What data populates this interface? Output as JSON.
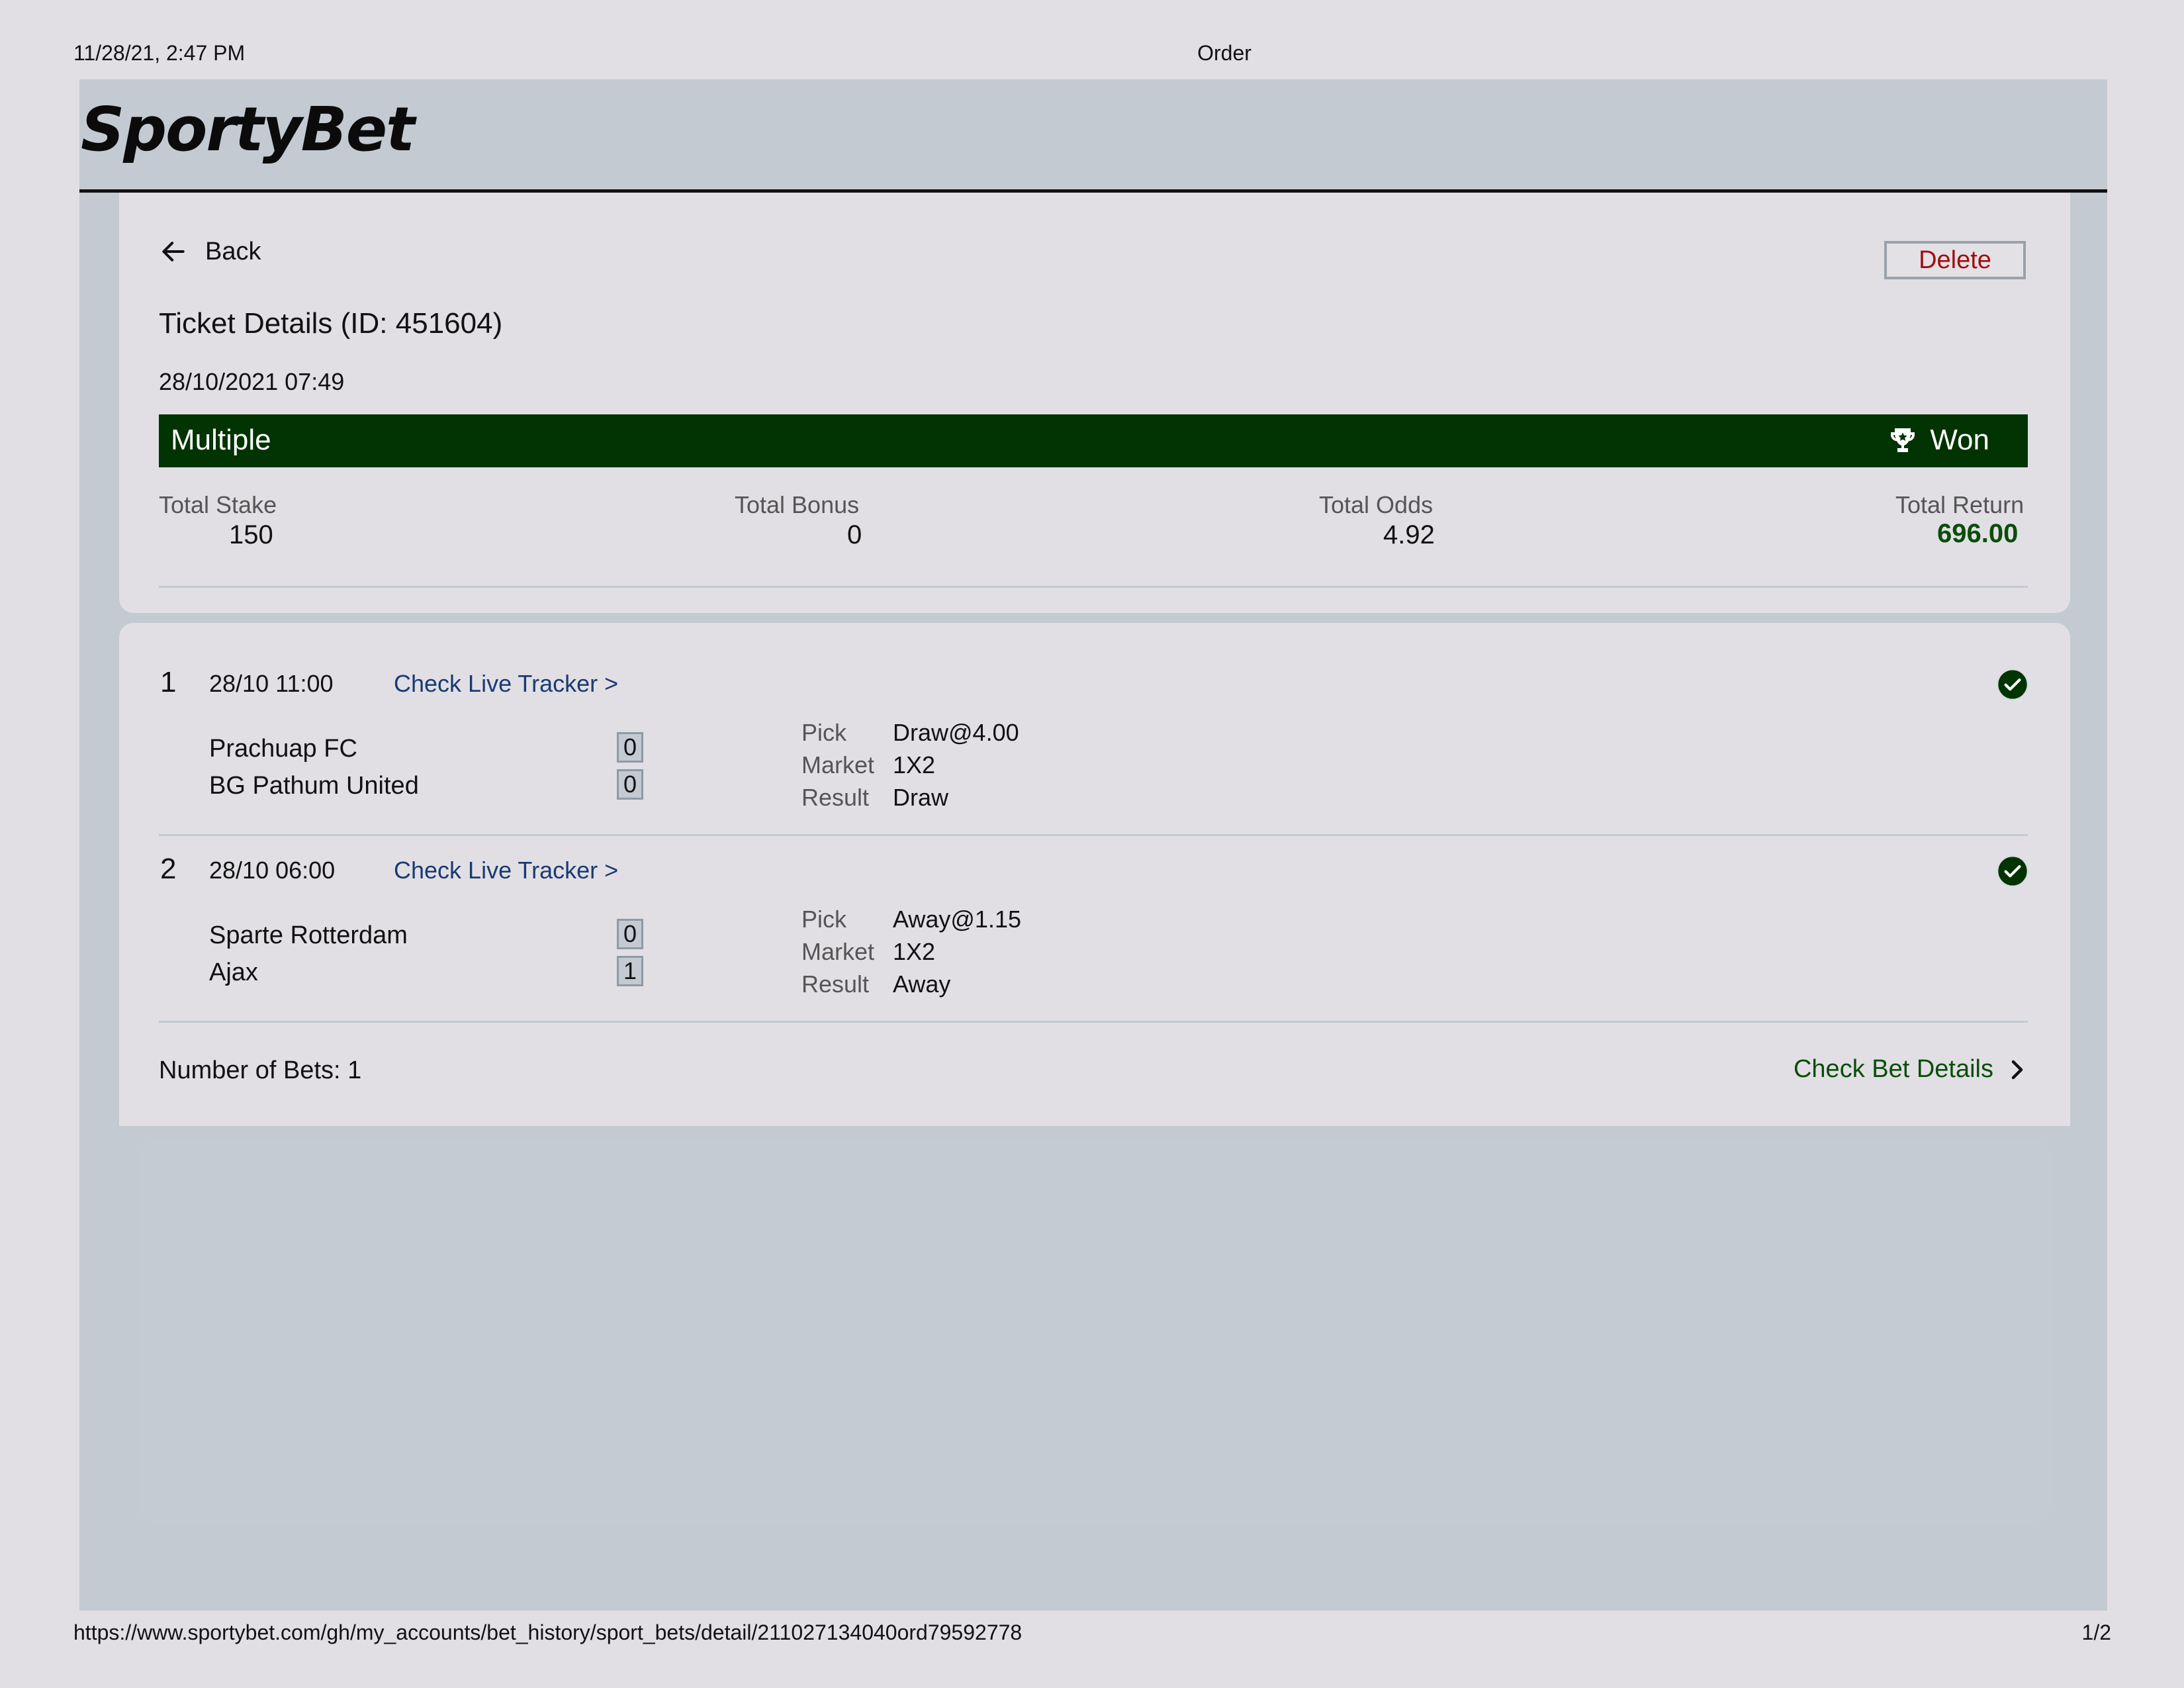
{
  "print_header": {
    "datetime": "11/28/21, 2:47 PM",
    "title": "Order"
  },
  "print_footer": {
    "url": "https://www.sportybet.com/gh/my_accounts/bet_history/sport_bets/detail/211027134040ord79592778",
    "page": "1/2"
  },
  "brand": {
    "logo_text": "SportyBet"
  },
  "nav": {
    "back_label": "Back",
    "delete_label": "Delete"
  },
  "ticket": {
    "title": "Ticket Details (ID: 451604)",
    "date": "28/10/2021 07:49",
    "bet_type": "Multiple",
    "status": "Won"
  },
  "summary": {
    "stake_label": "Total Stake",
    "stake": "150",
    "bonus_label": "Total Bonus",
    "bonus": "0",
    "odds_label": "Total Odds",
    "odds": "4.92",
    "return_label": "Total Return",
    "return": "696.00"
  },
  "selections": [
    {
      "index": "1",
      "time": "28/10 11:00",
      "tracker": "Check Live Tracker >",
      "home": "Prachuap FC",
      "home_score": "0",
      "away": "BG Pathum United",
      "away_score": "0",
      "pick_label": "Pick",
      "pick": "Draw@4.00",
      "market_label": "Market",
      "market": "1X2",
      "result_label": "Result",
      "result": "Draw"
    },
    {
      "index": "2",
      "time": "28/10 06:00",
      "tracker": "Check Live Tracker >",
      "home": "Sparte Rotterdam",
      "home_score": "0",
      "away": "Ajax",
      "away_score": "1",
      "pick_label": "Pick",
      "pick": "Away@1.15",
      "market_label": "Market",
      "market": "1X2",
      "result_label": "Result",
      "result": "Away"
    }
  ],
  "footer": {
    "num_bets": "Number of Bets: 1",
    "details_link": "Check Bet Details"
  },
  "colors": {
    "status_bar": "#023302",
    "won_green": "#0a4d0a",
    "delete_red": "#a10e0e",
    "link_blue": "#1a3a73"
  },
  "icons": {
    "back": "arrow-left-icon",
    "trophy": "trophy-icon",
    "won_check": "check-circle-icon",
    "chevron": "chevron-right-icon"
  }
}
